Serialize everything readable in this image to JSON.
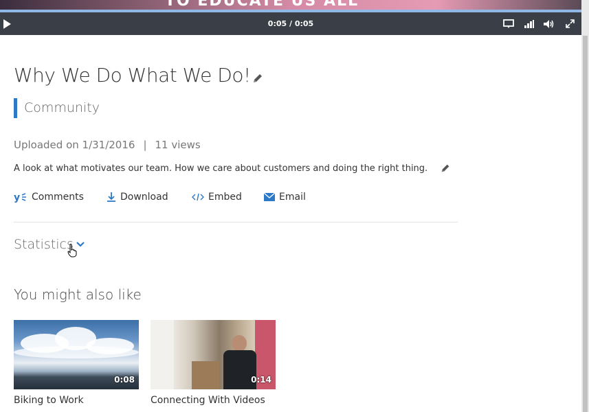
{
  "player": {
    "slogan": "TO EDUCATE US ALL",
    "time": "0:05 / 0:05",
    "progress": 1.0,
    "icons": [
      "play-icon",
      "captions-icon",
      "quality-icon",
      "volume-icon",
      "fullscreen-icon"
    ]
  },
  "video": {
    "title": "Why We Do What We Do!",
    "channel": "Community",
    "uploaded": "Uploaded on 1/31/2016",
    "separator": "|",
    "views": "11 views",
    "description": "A look at what motivates our team. How we care about customers and doing the right thing."
  },
  "actions": {
    "comments": "Comments",
    "download": "Download",
    "embed": "Embed",
    "email": "Email"
  },
  "statistics": {
    "label": "Statistics"
  },
  "related": {
    "heading": "You might also like",
    "items": [
      {
        "title": "Biking to Work",
        "duration": "0:08"
      },
      {
        "title": "Connecting With Videos",
        "duration": "0:14"
      }
    ]
  },
  "colors": {
    "accent": "#2b79c7",
    "control_bar": "#3a3f47",
    "progress": "#8fb8e6"
  }
}
